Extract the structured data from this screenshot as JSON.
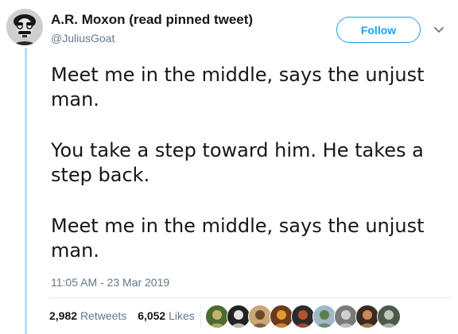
{
  "tweet": {
    "author_name": "A.R. Moxon (read pinned tweet)",
    "author_handle": "@JuliusGoat",
    "follow_label": "Follow",
    "paragraphs": [
      "Meet me in the middle, says the unjust\nman.",
      "You take a step toward him. He takes a\nstep back.",
      "Meet me in the middle, says the unjust\nman."
    ],
    "timestamp": "11:05 AM - 23 Mar 2019",
    "retweets_count": "2,982",
    "retweets_label": "Retweets",
    "likes_count": "6,052",
    "likes_label": "Likes"
  },
  "likers": [
    {
      "name": "liker-avatar-1",
      "color": "#4a6b2e",
      "accent": "#c9b26b"
    },
    {
      "name": "liker-avatar-2",
      "color": "#222222",
      "accent": "#e4e4e4"
    },
    {
      "name": "liker-avatar-3",
      "color": "#c8a77a",
      "accent": "#6d4a2a"
    },
    {
      "name": "liker-avatar-4",
      "color": "#6b3a1e",
      "accent": "#e29a2a"
    },
    {
      "name": "liker-avatar-5",
      "color": "#2b2b2b",
      "accent": "#b5532a"
    },
    {
      "name": "liker-avatar-6",
      "color": "#9fb7c9",
      "accent": "#5a7f4a"
    },
    {
      "name": "liker-avatar-7",
      "color": "#7a7a7a",
      "accent": "#d0d0d0"
    },
    {
      "name": "liker-avatar-8",
      "color": "#3a2a22",
      "accent": "#c98a5a"
    },
    {
      "name": "liker-avatar-9",
      "color": "#4d5a4a",
      "accent": "#bfc9bb"
    }
  ],
  "colors": {
    "accent": "#1da1f2",
    "thread_line": "#b9dff5",
    "secondary_text": "#657786"
  }
}
